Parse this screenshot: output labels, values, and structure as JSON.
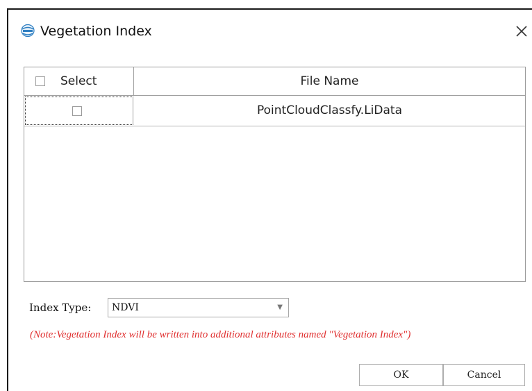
{
  "window": {
    "title": "Vegetation Index",
    "icon": "app-logo-icon",
    "close_icon": "close-icon"
  },
  "table": {
    "columns": [
      "Select",
      "File Name"
    ],
    "rows": [
      {
        "checked": false,
        "file_name": "PointCloudClassfy.LiData"
      }
    ]
  },
  "index_type": {
    "label": "Index Type:",
    "value": "NDVI"
  },
  "note": "(Note:Vegetation Index will be written into additional attributes named \"Vegetation Index\")",
  "buttons": {
    "ok": "OK",
    "cancel": "Cancel"
  }
}
